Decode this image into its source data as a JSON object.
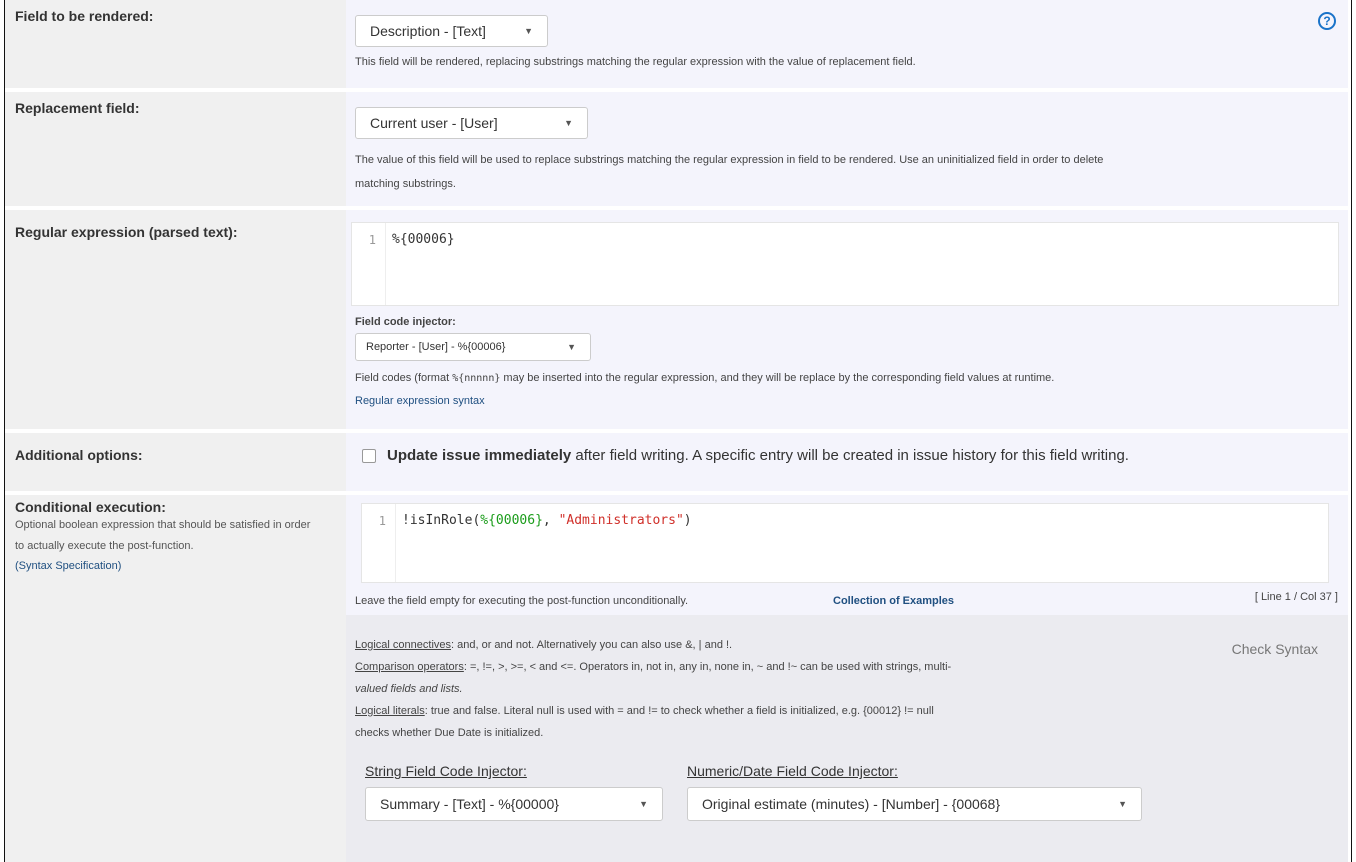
{
  "rows": {
    "field_to_render": {
      "label": "Field to be rendered:",
      "select_value": "Description - [Text]",
      "help": "This field will be rendered, replacing substrings matching the regular expression with the value of replacement field."
    },
    "replacement": {
      "label": "Replacement field:",
      "select_value": "Current user - [User]",
      "help_line1": "The value of this field will be used to replace substrings matching the regular expression in field to be rendered. Use an uninitialized field in order to delete",
      "help_line2": "matching substrings."
    },
    "regex": {
      "label": "Regular expression (parsed text):",
      "line_number": "1",
      "code": "%{00006}",
      "injector_label": "Field code injector:",
      "injector_value": "Reporter - [User] - %{00006}",
      "help_pre": "Field codes (format ",
      "help_code": "%{nnnnn}",
      "help_post": " may be inserted into the regular expression, and they will be replace by the corresponding field values at runtime.",
      "syntax_link": "Regular expression syntax"
    },
    "additional": {
      "label": "Additional options:",
      "bold_text": "Update issue immediately",
      "rest_text": " after field writing. A specific entry will be created in issue history for this field writing."
    },
    "conditional": {
      "label": "Conditional execution:",
      "desc": "Optional boolean expression that should be satisfied in order to actually execute the post-function.",
      "syntax_link": "(Syntax Specification)",
      "line_number": "1",
      "code_prefix": "!isInRole(",
      "code_field": "%{00006}",
      "code_sep": ", ",
      "code_string": "\"Administrators\"",
      "code_suffix": ")",
      "empty_help": "Leave the field empty for executing the post-function unconditionally.",
      "examples_link": "Collection of Examples",
      "cursor_pos": "[ Line 1 / Col 37 ]",
      "check_syntax": "Check Syntax",
      "logical_connectives_label": "Logical connectives",
      "logical_connectives_text": ": and, or and not. Alternatively you can also use &, | and !.",
      "comparison_label": "Comparison operators",
      "comparison_text": ": =, !=, >, >=, < and <=. Operators in, not in, any in, none in, ~ and !~ can be used with strings, multi-",
      "comparison_text2": "valued fields and lists.",
      "literals_label": "Logical literals",
      "literals_text": ": true and false. Literal null is used with = and != to check whether a field is initialized, e.g. {00012} != null",
      "literals_text2": "checks whether Due Date is initialized.",
      "string_injector_title": "String Field Code Injector:",
      "string_injector_value": "Summary - [Text] - %{00000}",
      "numeric_injector_title": "Numeric/Date Field Code Injector:",
      "numeric_injector_value": "Original estimate (minutes) - [Number] - {00068}"
    }
  },
  "icons": {
    "help": "help-circle-icon",
    "caret": "chevron-down-icon"
  },
  "colors": {
    "label_bg": "#f0f0f0",
    "value_bg": "#f4f4fc",
    "link": "#205081",
    "code_green": "#1a9c1a",
    "code_red": "#d0302a",
    "help_icon": "#1a73c9"
  }
}
